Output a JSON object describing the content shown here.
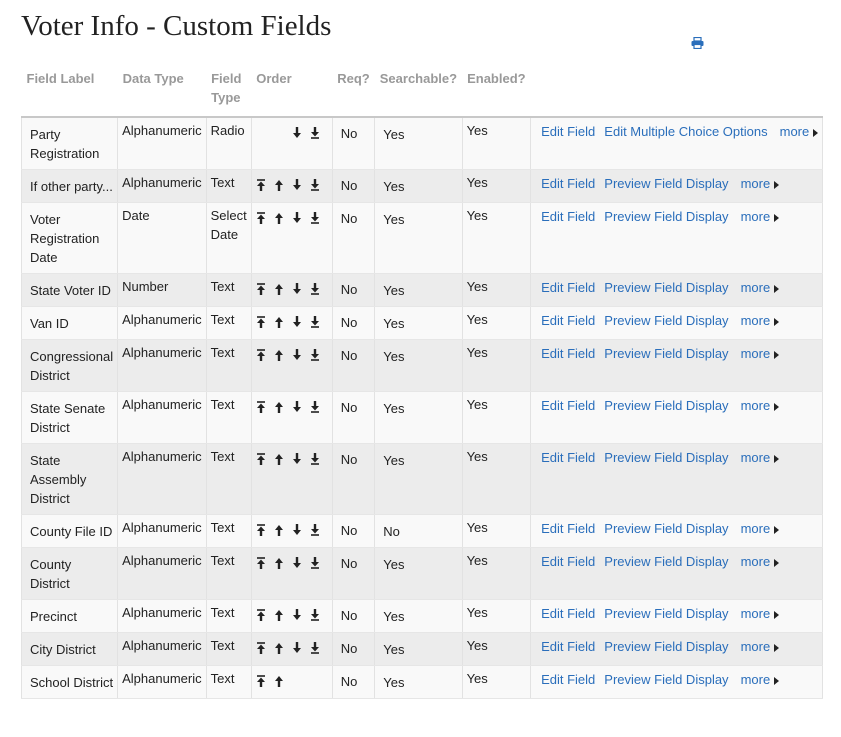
{
  "page": {
    "title": "Voter Info - Custom Fields",
    "print_icon": "print-icon"
  },
  "columns": [
    "Field Label",
    "Data Type",
    "Field Type",
    "Order",
    "Req?",
    "Searchable?",
    "Enabled?"
  ],
  "actions": {
    "edit": "Edit Field",
    "preview": "Preview Field Display",
    "edit_mc": "Edit Multiple Choice Options",
    "more": "more"
  },
  "icons": {
    "top": "arrow-to-top-icon",
    "up": "arrow-up-icon",
    "down": "arrow-down-icon",
    "bottom": "arrow-to-bottom-icon",
    "more": "triangle-right-icon"
  },
  "rows": [
    {
      "label": "Party Registration",
      "data_type": "Alphanumeric",
      "field_type": "Radio",
      "order": [
        "",
        "",
        "down",
        "bottom"
      ],
      "req": "No",
      "searchable": "Yes",
      "enabled": "Yes",
      "second_action": "edit_mc"
    },
    {
      "label": "If other party...",
      "data_type": "Alphanumeric",
      "field_type": "Text",
      "order": [
        "top",
        "up",
        "down",
        "bottom"
      ],
      "req": "No",
      "searchable": "Yes",
      "enabled": "Yes",
      "second_action": "preview"
    },
    {
      "label": "Voter Registration Date",
      "data_type": "Date",
      "field_type": "Select Date",
      "order": [
        "top",
        "up",
        "down",
        "bottom"
      ],
      "req": "No",
      "searchable": "Yes",
      "enabled": "Yes",
      "second_action": "preview"
    },
    {
      "label": "State Voter ID",
      "data_type": "Number",
      "field_type": "Text",
      "order": [
        "top",
        "up",
        "down",
        "bottom"
      ],
      "req": "No",
      "searchable": "Yes",
      "enabled": "Yes",
      "second_action": "preview"
    },
    {
      "label": "Van ID",
      "data_type": "Alphanumeric",
      "field_type": "Text",
      "order": [
        "top",
        "up",
        "down",
        "bottom"
      ],
      "req": "No",
      "searchable": "Yes",
      "enabled": "Yes",
      "second_action": "preview"
    },
    {
      "label": "Congressional District",
      "data_type": "Alphanumeric",
      "field_type": "Text",
      "order": [
        "top",
        "up",
        "down",
        "bottom"
      ],
      "req": "No",
      "searchable": "Yes",
      "enabled": "Yes",
      "second_action": "preview"
    },
    {
      "label": "State Senate District",
      "data_type": "Alphanumeric",
      "field_type": "Text",
      "order": [
        "top",
        "up",
        "down",
        "bottom"
      ],
      "req": "No",
      "searchable": "Yes",
      "enabled": "Yes",
      "second_action": "preview"
    },
    {
      "label": "State Assembly District",
      "data_type": "Alphanumeric",
      "field_type": "Text",
      "order": [
        "top",
        "up",
        "down",
        "bottom"
      ],
      "req": "No",
      "searchable": "Yes",
      "enabled": "Yes",
      "second_action": "preview"
    },
    {
      "label": "County File ID",
      "data_type": "Alphanumeric",
      "field_type": "Text",
      "order": [
        "top",
        "up",
        "down",
        "bottom"
      ],
      "req": "No",
      "searchable": "No",
      "enabled": "Yes",
      "second_action": "preview"
    },
    {
      "label": "County District",
      "data_type": "Alphanumeric",
      "field_type": "Text",
      "order": [
        "top",
        "up",
        "down",
        "bottom"
      ],
      "req": "No",
      "searchable": "Yes",
      "enabled": "Yes",
      "second_action": "preview"
    },
    {
      "label": "Precinct",
      "data_type": "Alphanumeric",
      "field_type": "Text",
      "order": [
        "top",
        "up",
        "down",
        "bottom"
      ],
      "req": "No",
      "searchable": "Yes",
      "enabled": "Yes",
      "second_action": "preview"
    },
    {
      "label": "City District",
      "data_type": "Alphanumeric",
      "field_type": "Text",
      "order": [
        "top",
        "up",
        "down",
        "bottom"
      ],
      "req": "No",
      "searchable": "Yes",
      "enabled": "Yes",
      "second_action": "preview"
    },
    {
      "label": "School District",
      "data_type": "Alphanumeric",
      "field_type": "Text",
      "order": [
        "top",
        "up",
        "",
        ""
      ],
      "req": "No",
      "searchable": "Yes",
      "enabled": "Yes",
      "second_action": "preview"
    }
  ],
  "colors": {
    "link": "#2a6ebb",
    "header_text": "#999999",
    "row_light": "#f9f9f9",
    "row_dark": "#ececec"
  }
}
